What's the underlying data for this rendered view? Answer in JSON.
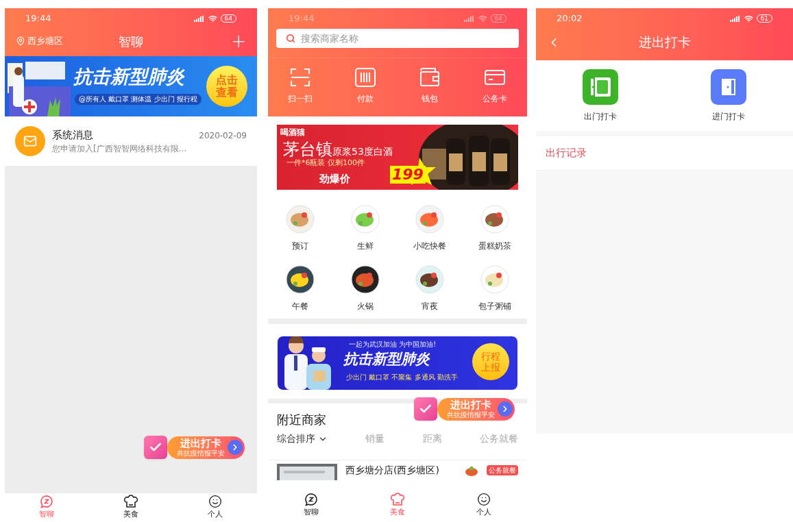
{
  "chat_screen": {
    "status_bar": {
      "time": "19:44",
      "battery": "64"
    },
    "header": {
      "location": "西乡塘区",
      "title": "智聊",
      "action": "+"
    },
    "banner": {
      "title": "抗击新型肺炎",
      "subtitle": "@所有人 戴口罩 测体温 少出门 报行程",
      "button_lines": [
        "点击",
        "查看"
      ]
    },
    "messages": [
      {
        "title": "系统消息",
        "preview": "您申请加入[广西智智网络科技有限...",
        "date": "2020-02-09"
      }
    ],
    "floating_badge": {
      "title": "进出打卡",
      "subtitle": "共抗疫情报平安"
    },
    "tab_bar": [
      {
        "label": "智聊",
        "kind": "chat",
        "selected": true
      },
      {
        "label": "美食",
        "kind": "food",
        "selected": false
      },
      {
        "label": "个人",
        "kind": "profile",
        "selected": false
      }
    ]
  },
  "food_screen": {
    "status_bar": {
      "time": "19:44",
      "battery": "64"
    },
    "search": {
      "placeholder": "搜索商家名称"
    },
    "quick_actions": [
      {
        "label": "扫一扫",
        "kind": "scan"
      },
      {
        "label": "付款",
        "kind": "pay"
      },
      {
        "label": "钱包",
        "kind": "wallet"
      },
      {
        "label": "公务卡",
        "kind": "card"
      }
    ],
    "promo_banner": {
      "brand": "喝酒猫",
      "headline": "茅台镇",
      "headline_detail": "原浆53度白酒",
      "offer": "一件*6瓶装 仅剩100件",
      "price_label": "劲爆价",
      "price": "199"
    },
    "categories": [
      {
        "label": "预订"
      },
      {
        "label": "生鲜"
      },
      {
        "label": "小吃快餐"
      },
      {
        "label": "蛋糕奶茶"
      },
      {
        "label": "午餐"
      },
      {
        "label": "火锅"
      },
      {
        "label": "宵夜"
      },
      {
        "label": "包子粥铺"
      }
    ],
    "campaign_banner": {
      "slogan": "一起为武汉加油 为中国加油!",
      "title": "抗击新型肺炎",
      "tips": "少出门 戴口罩 不聚集 多通风 勤洗手",
      "button_lines": [
        "行程",
        "上报"
      ]
    },
    "floating_badge": {
      "title": "进出打卡",
      "subtitle": "共抗疫情报平安"
    },
    "nearby": {
      "title": "附近商家",
      "sort_options": [
        {
          "label": "综合排序",
          "selected": true
        },
        {
          "label": "销量",
          "selected": false
        },
        {
          "label": "距离",
          "selected": false
        },
        {
          "label": "公务就餐",
          "selected": false
        }
      ],
      "shop": {
        "name": "西乡塘分店(西乡塘区)",
        "tag": "公务就餐"
      }
    },
    "tab_bar": [
      {
        "label": "智聊",
        "kind": "chat",
        "selected": false
      },
      {
        "label": "美食",
        "kind": "food",
        "selected": true
      },
      {
        "label": "个人",
        "kind": "profile",
        "selected": false
      }
    ]
  },
  "checkin_screen": {
    "status_bar": {
      "time": "20:02",
      "battery": "61"
    },
    "title": "进出打卡",
    "actions": [
      {
        "label": "出门打卡",
        "kind": "exit"
      },
      {
        "label": "进门打卡",
        "kind": "enter"
      }
    ],
    "records_link": "出行记录"
  }
}
